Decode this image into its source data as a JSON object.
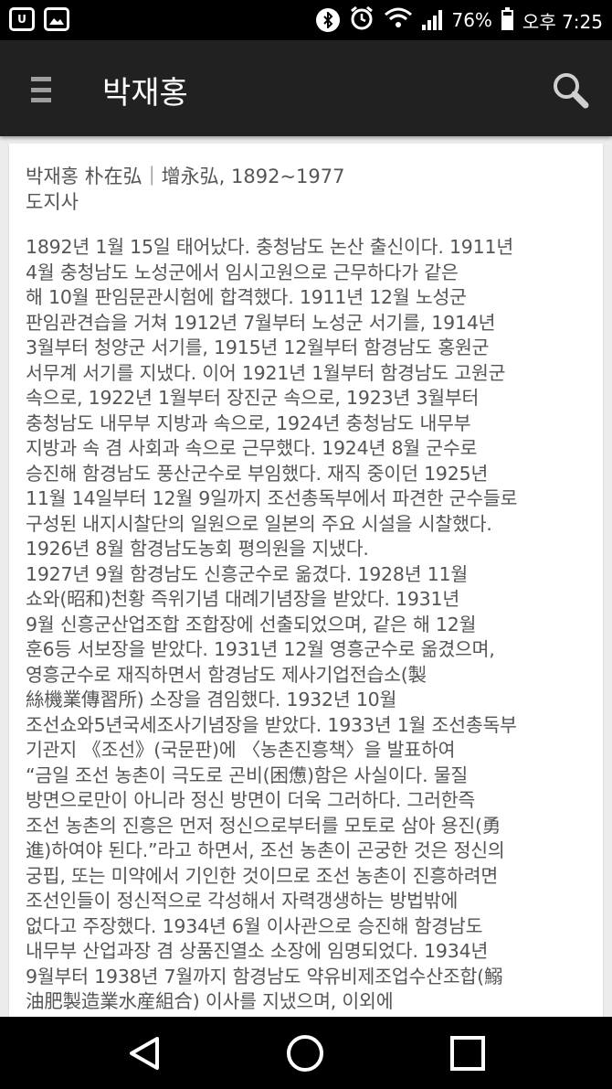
{
  "status_bar": {
    "left_icons": [
      "u-plus-icon",
      "image-icon"
    ],
    "right_icons": [
      "bluetooth-icon",
      "alarm-icon",
      "wifi-icon",
      "signal-icon",
      "battery-icon"
    ],
    "battery_level": 0.76,
    "battery_percent": "76%",
    "time": "오후 7:25"
  },
  "app_bar": {
    "title": "박재홍",
    "menu_icon": "menu-icon",
    "search_icon": "search-icon"
  },
  "entry": {
    "heading_line1": "박재홍 朴在弘｜增永弘, 1892~1977",
    "heading_line2": "도지사",
    "body": "1892년 1월 15일 태어났다. 충청남도 논산 출신이다. 1911년\n4월 충청남도 노성군에서 임시고원으로 근무하다가 같은\n해 10월 판임문관시험에 합격했다. 1911년 12월 노성군\n판임관견습을 거쳐 1912년 7월부터 노성군 서기를, 1914년\n3월부터 청양군 서기를, 1915년 12월부터 함경남도 홍원군\n서무계 서기를 지냈다. 이어 1921년 1월부터 함경남도 고원군\n속으로, 1922년 1월부터 장진군 속으로, 1923년 3월부터\n충청남도 내무부 지방과 속으로, 1924년 충청남도 내무부\n지방과 속 겸 사회과 속으로 근무했다. 1924년 8월 군수로\n승진해 함경남도 풍산군수로 부임했다. 재직 중이던 1925년\n11월 14일부터 12월 9일까지 조선총독부에서 파견한 군수들로\n구성된 내지시찰단의 일원으로 일본의 주요 시설을 시찰했다.\n1926년 8월 함경남도농회 평의원을 지냈다.\n1927년 9월 함경남도 신흥군수로 옮겼다. 1928년 11월\n쇼와(昭和)천황 즉위기념 대례기념장을 받았다. 1931년\n9월 신흥군산업조합 조합장에 선출되었으며, 같은 해 12월\n훈6등 서보장을 받았다. 1931년 12월 영흥군수로 옮겼으며,\n영흥군수로 재직하면서 함경남도 제사기업전습소(製\n絲機業傳習所) 소장을 겸임했다. 1932년 10월\n조선쇼와5년국세조사기념장을 받았다. 1933년 1월 조선총독부\n기관지 《조선》(국문판)에 〈농촌진흥책〉을 발표하여\n“금일 조선 농촌이 극도로 곤비(困憊)함은 사실이다. 물질\n방면으로만이 아니라 정신 방면이 더욱 그러하다. 그러한즉\n조선 농촌의 진흥은 먼저 정신으로부터를 모토로 삼아 용진(勇\n進)하여야 된다.”라고 하면서, 조선 농촌이 곤궁한 것은 정신의\n궁핍, 또는 미약에서 기인한 것이므로 조선 농촌이 진흥하려면\n조선인들이 정신적으로 각성해서 자력갱생하는 방법밖에\n없다고 주장했다. 1934년 6월 이사관으로 승진해 함경남도\n내무부 산업과장 겸 상품진열소 소장에 임명되었다. 1934년\n9월부터 1938년 7월까지 함경남도 약유비제조업수산조합(鰯\n油肥製造業水産組合) 이사를 지냈으며, 이외에"
  },
  "nav_bar": {
    "buttons": [
      "back-icon",
      "home-icon",
      "recent-apps-icon"
    ]
  },
  "colors": {
    "status_bar": "#000000",
    "app_bar": "#212121",
    "background": "#ececec",
    "card": "#ffffff",
    "text": "#555555"
  }
}
